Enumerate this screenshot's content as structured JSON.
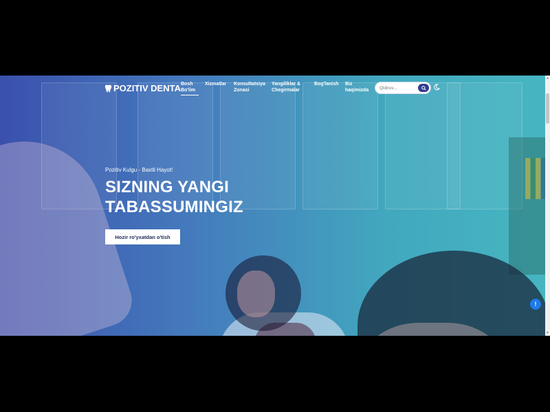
{
  "brand": {
    "name": "POZITIV DENTA",
    "icon": "tooth-icon"
  },
  "nav": {
    "items": [
      {
        "label": "Bosh Bo'lim",
        "active": true
      },
      {
        "label": "Xizmatlar",
        "active": false
      },
      {
        "label": "Konsultatsiya Zonasi",
        "active": false
      },
      {
        "label": "Yangiliklar & Chegirmalar",
        "active": false
      },
      {
        "label": "Bog'lanish",
        "active": false
      },
      {
        "label": "Biz haqimizda",
        "active": false
      }
    ]
  },
  "search": {
    "placeholder": "Qidiruv...",
    "icon": "search-icon"
  },
  "theme_toggle": {
    "icon": "moon-icon"
  },
  "hero": {
    "tagline": "Pozitiv Kulgu - Baxtli Hayot!",
    "headline_line1": "SIZNING YANGI",
    "headline_line2": "TABASSUMINGIZ",
    "cta_label": "Hozir ro'yxatdan o'tish"
  },
  "floating_button": {
    "label": "!",
    "icon": "info-icon",
    "color": "#1e7be8"
  },
  "colors": {
    "accent": "#2f3d8f",
    "gradient_start": "#3448aa",
    "gradient_end": "#2eb6be"
  }
}
